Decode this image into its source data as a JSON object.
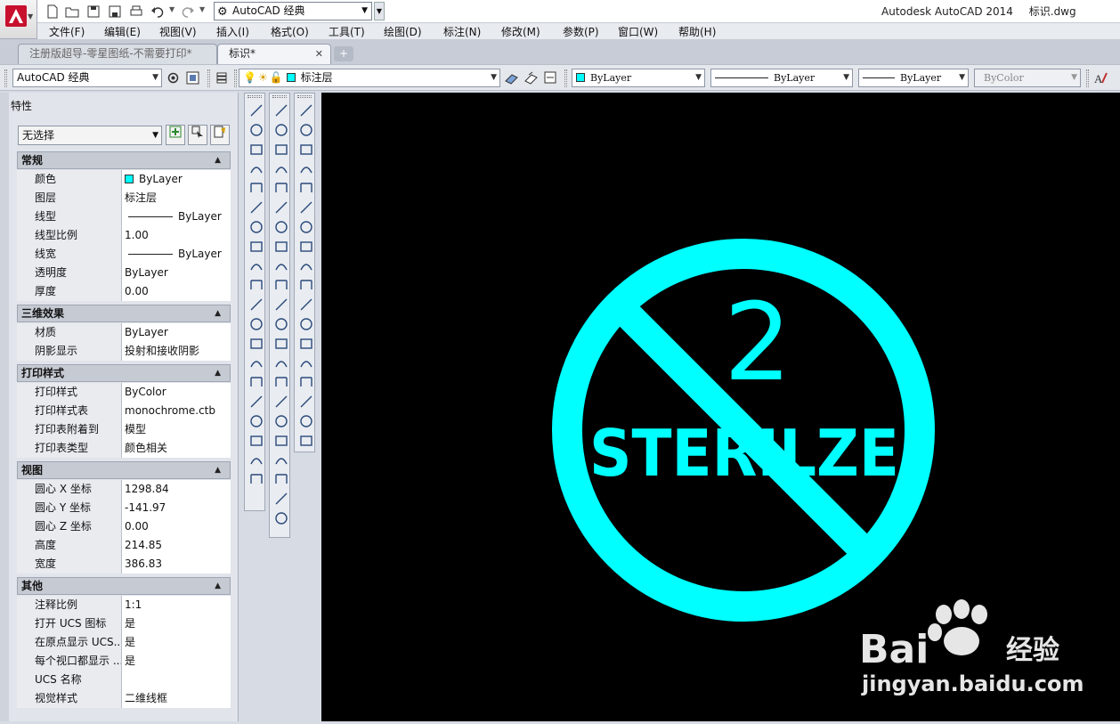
{
  "title_bar": {
    "workspace": "AutoCAD 经典",
    "app_name": "Autodesk AutoCAD 2014",
    "file_name": "标识.dwg"
  },
  "menu": [
    "文件(F)",
    "编辑(E)",
    "视图(V)",
    "插入(I)",
    "格式(O)",
    "工具(T)",
    "绘图(D)",
    "标注(N)",
    "修改(M)",
    "参数(P)",
    "窗口(W)",
    "帮助(H)"
  ],
  "tabs": [
    "注册版超导-零星图纸-不需要打印*",
    "标识*"
  ],
  "toolbar": {
    "workspace": "AutoCAD 经典",
    "layer": "标注层",
    "color": "ByLayer",
    "linetype": "ByLayer",
    "lineweight": "ByLayer",
    "plotstyle": "ByColor"
  },
  "properties": {
    "title": "特性",
    "selection": "无选择",
    "sections": [
      {
        "name": "常规",
        "rows": [
          {
            "label": "颜色",
            "value": "ByLayer"
          },
          {
            "label": "图层",
            "value": "标注层"
          },
          {
            "label": "线型",
            "value": "ByLayer"
          },
          {
            "label": "线型比例",
            "value": "1.00"
          },
          {
            "label": "线宽",
            "value": "ByLayer"
          },
          {
            "label": "透明度",
            "value": "ByLayer"
          },
          {
            "label": "厚度",
            "value": "0.00"
          }
        ]
      },
      {
        "name": "三维效果",
        "rows": [
          {
            "label": "材质",
            "value": "ByLayer"
          },
          {
            "label": "阴影显示",
            "value": "投射和接收阴影"
          }
        ]
      },
      {
        "name": "打印样式",
        "rows": [
          {
            "label": "打印样式",
            "value": "ByColor"
          },
          {
            "label": "打印样式表",
            "value": "monochrome.ctb"
          },
          {
            "label": "打印表附着到",
            "value": "模型"
          },
          {
            "label": "打印表类型",
            "value": "颜色相关"
          }
        ]
      },
      {
        "name": "视图",
        "rows": [
          {
            "label": "圆心 X 坐标",
            "value": "1298.84"
          },
          {
            "label": "圆心 Y 坐标",
            "value": "-141.97"
          },
          {
            "label": "圆心 Z 坐标",
            "value": "0.00"
          },
          {
            "label": "高度",
            "value": "214.85"
          },
          {
            "label": "宽度",
            "value": "386.83"
          }
        ]
      },
      {
        "name": "其他",
        "rows": [
          {
            "label": "注释比例",
            "value": "1:1"
          },
          {
            "label": "打开 UCS 图标",
            "value": "是"
          },
          {
            "label": "在原点显示 UCS...",
            "value": "是"
          },
          {
            "label": "每个视口都显示 ...",
            "value": "是"
          },
          {
            "label": "UCS 名称",
            "value": ""
          },
          {
            "label": "视觉样式",
            "value": "二维线框"
          }
        ]
      }
    ]
  },
  "drawing": {
    "number": "2",
    "word": "STERILZE",
    "color": "#00ffff",
    "background": "#000000"
  },
  "watermark": {
    "brand": "Bai",
    "brand_suffix": "经验",
    "url": "jingyan.baidu.com"
  }
}
